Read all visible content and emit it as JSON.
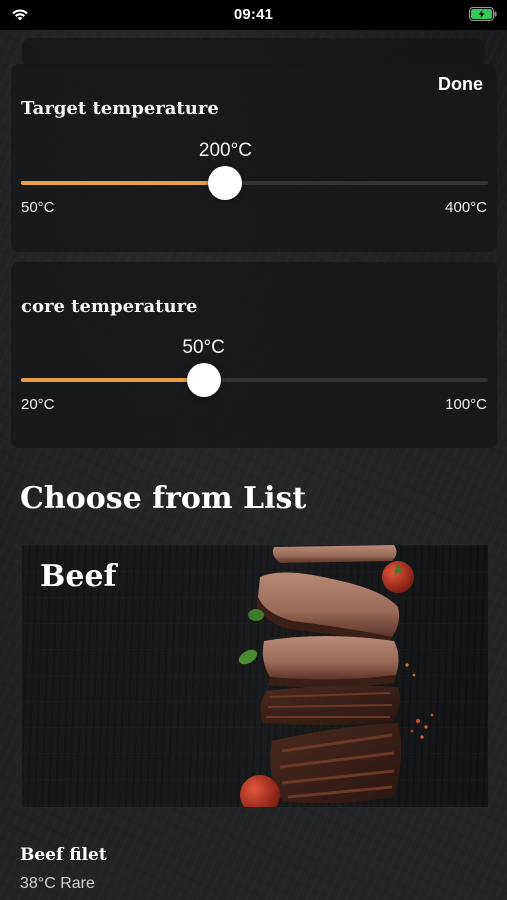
{
  "status_bar": {
    "time": "09:41",
    "icons": [
      "wifi-icon",
      "battery-charging-icon"
    ],
    "battery_color": "#34c759"
  },
  "target_panel": {
    "done_label": "Done",
    "title": "Target temperature",
    "value_label": "200°C",
    "min_label": "50°C",
    "max_label": "400°C",
    "value": 200,
    "min": 50,
    "max": 400
  },
  "core_panel": {
    "title": "core temperature",
    "value_label": "50°C",
    "min_label": "20°C",
    "max_label": "100°C",
    "value": 50,
    "min": 20,
    "max": 100
  },
  "list": {
    "heading": "Choose from List",
    "category": {
      "title": "Beef",
      "image": "sliced-steak-image"
    },
    "items": [
      {
        "name": "Beef filet",
        "detail": "38°C Rare"
      }
    ]
  },
  "colors": {
    "accent": "#e5a049",
    "slider_track": "#333436",
    "background": "#1b1c1d"
  }
}
